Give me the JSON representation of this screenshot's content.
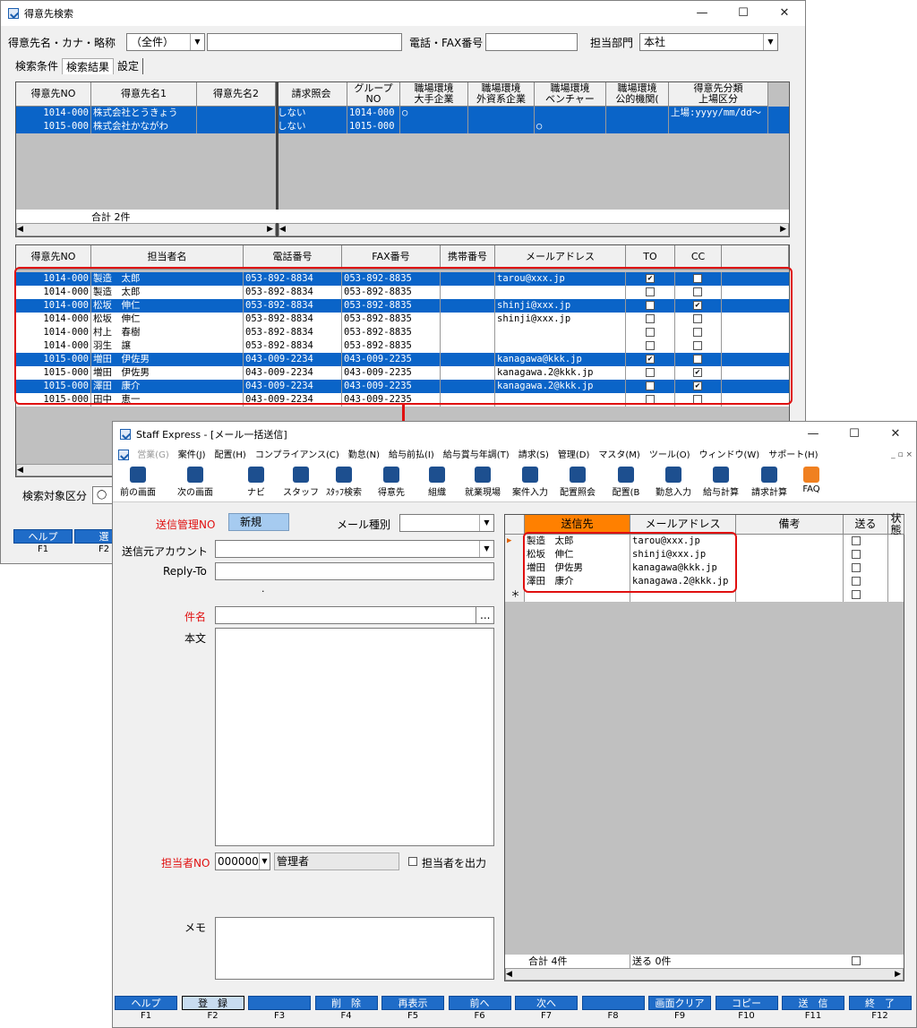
{
  "search_window": {
    "title": "得意先検索",
    "search_label": "得意先名・カナ・略称",
    "kind_value": "（全件）",
    "name_value": "",
    "phone_label": "電話・FAX番号",
    "phone_value": "",
    "dept_label": "担当部門",
    "dept_value": "本社",
    "tabs": [
      "検索条件",
      "検索結果",
      "設定"
    ],
    "upper_headers": [
      "得意先NO",
      "得意先名1",
      "得意先名2",
      "請求照会",
      "グループ\nNO",
      "職場環境\n大手企業",
      "職場環境\n外資系企業",
      "職場環境\nベンチャー",
      "職場環境\n公的機関(",
      "得意先分類\n上場区分"
    ],
    "upper_rows": [
      {
        "no": "1014-000",
        "name1": "株式会社とうきょう",
        "name2": "",
        "billing": "しない",
        "group": "1014-000",
        "big": "○",
        "foreign": "",
        "venture": "",
        "public": "",
        "cls": "上場:yyyy/mm/dd～"
      },
      {
        "no": "1015-000",
        "name1": "株式会社かながわ",
        "name2": "",
        "billing": "しない",
        "group": "1015-000",
        "big": "",
        "foreign": "",
        "venture": "○",
        "public": "",
        "cls": ""
      }
    ],
    "upper_total": "合計 2件",
    "lower_headers": [
      "得意先NO",
      "担当者名",
      "電話番号",
      "FAX番号",
      "携帯番号",
      "メールアドレス",
      "TO",
      "CC"
    ],
    "lower_rows": [
      {
        "no": "1014-000",
        "name": "製造　太郎",
        "tel": "053-892-8834",
        "fax": "053-892-8835",
        "mobile": "",
        "mail": "tarou@xxx.jp",
        "to": "✔",
        "cc": "",
        "sel": true
      },
      {
        "no": "1014-000",
        "name": "製造　太郎",
        "tel": "053-892-8834",
        "fax": "053-892-8835",
        "mobile": "",
        "mail": "",
        "to": "",
        "cc": "",
        "sel": false
      },
      {
        "no": "1014-000",
        "name": "松坂　伸仁",
        "tel": "053-892-8834",
        "fax": "053-892-8835",
        "mobile": "",
        "mail": "shinji@xxx.jp",
        "to": "",
        "cc": "✔",
        "sel": true
      },
      {
        "no": "1014-000",
        "name": "松坂　伸仁",
        "tel": "053-892-8834",
        "fax": "053-892-8835",
        "mobile": "",
        "mail": "shinji@xxx.jp",
        "to": "",
        "cc": "",
        "sel": false
      },
      {
        "no": "1014-000",
        "name": "村上　春樹",
        "tel": "053-892-8834",
        "fax": "053-892-8835",
        "mobile": "",
        "mail": "",
        "to": "",
        "cc": "",
        "sel": false
      },
      {
        "no": "1014-000",
        "name": "羽生　譲",
        "tel": "053-892-8834",
        "fax": "053-892-8835",
        "mobile": "",
        "mail": "",
        "to": "",
        "cc": "",
        "sel": false
      },
      {
        "no": "1015-000",
        "name": "増田　伊佐男",
        "tel": "043-009-2234",
        "fax": "043-009-2235",
        "mobile": "",
        "mail": "kanagawa@kkk.jp",
        "to": "✔",
        "cc": "",
        "sel": true
      },
      {
        "no": "1015-000",
        "name": "増田　伊佐男",
        "tel": "043-009-2234",
        "fax": "043-009-2235",
        "mobile": "",
        "mail": "kanagawa.2@kkk.jp",
        "to": "",
        "cc": "✔",
        "sel": false
      },
      {
        "no": "1015-000",
        "name": "澤田　康介",
        "tel": "043-009-2234",
        "fax": "043-009-2235",
        "mobile": "",
        "mail": "kanagawa.2@kkk.jp",
        "to": "",
        "cc": "✔",
        "sel": true
      },
      {
        "no": "1015-000",
        "name": "田中　恵一",
        "tel": "043-009-2234",
        "fax": "043-009-2235",
        "mobile": "",
        "mail": "",
        "to": "",
        "cc": "",
        "sel": false
      }
    ],
    "search_target_label": "検索対象区分",
    "fkeys": [
      {
        "label": "ヘルプ",
        "fn": "F1"
      },
      {
        "label": "選",
        "fn": "F2"
      }
    ]
  },
  "mail_window": {
    "title": "Staff Express - [メール一括送信]",
    "menu": [
      "営業(G)",
      "案件(J)",
      "配置(H)",
      "コンプライアンス(C)",
      "勤怠(N)",
      "給与前払(I)",
      "給与賞与年調(T)",
      "請求(S)",
      "管理(D)",
      "マスタ(M)",
      "ツール(O)",
      "ウィンドウ(W)",
      "サポート(H)"
    ],
    "mdi_controls": "_ ▫ ×",
    "toolbar": [
      "前の画面",
      "次の画面",
      "ナビ",
      "スタッフ",
      "ｽﾀｯﾌ検索",
      "得意先",
      "組織",
      "就業現場",
      "案件入力",
      "配置照会",
      "配置(B",
      "勤怠入力",
      "給与計算",
      "請求計算",
      "FAQ"
    ],
    "form": {
      "send_no_label": "送信管理NO",
      "send_no_value": "新規",
      "mail_type_label": "メール種別",
      "account_label": "送信元アカウント",
      "reply_label": "Reply-To",
      "subject_label": "件名",
      "body_label": "本文",
      "staff_no_label": "担当者NO",
      "staff_no_value": "000000",
      "staff_name": "管理者",
      "print_staff_label": "担当者を出力",
      "memo_label": "メモ",
      "ellipsis": "...",
      "dot": "."
    },
    "grid_headers": [
      "送信先",
      "メールアドレス",
      "備考",
      "送る",
      "状態"
    ],
    "grid_rows": [
      {
        "name": "製造　太郎",
        "mail": "tarou@xxx.jp"
      },
      {
        "name": "松坂　伸仁",
        "mail": "shinji@xxx.jp"
      },
      {
        "name": "増田　伊佐男",
        "mail": "kanagawa@kkk.jp"
      },
      {
        "name": "澤田　康介",
        "mail": "kanagawa.2@kkk.jp"
      }
    ],
    "new_row_marker": "＊",
    "total_label": "合計 4件",
    "send_total": "送る 0件",
    "fkeys": [
      {
        "label": "ヘルプ",
        "fn": "F1"
      },
      {
        "label": "登　録",
        "fn": "F2"
      },
      {
        "label": "",
        "fn": "F3"
      },
      {
        "label": "削　除",
        "fn": "F4"
      },
      {
        "label": "再表示",
        "fn": "F5"
      },
      {
        "label": "前へ",
        "fn": "F6"
      },
      {
        "label": "次へ",
        "fn": "F7"
      },
      {
        "label": "",
        "fn": "F8"
      },
      {
        "label": "画面クリア",
        "fn": "F9"
      },
      {
        "label": "コピー",
        "fn": "F10"
      },
      {
        "label": "送　信",
        "fn": "F11"
      },
      {
        "label": "終　了",
        "fn": "F12"
      }
    ]
  },
  "colors": {
    "selection": "#0a64c8",
    "highlight_box": "#e01010",
    "header_orange": "#ff8000",
    "fkey_blue": "#1f6cc8",
    "required_label": "#e01010"
  }
}
